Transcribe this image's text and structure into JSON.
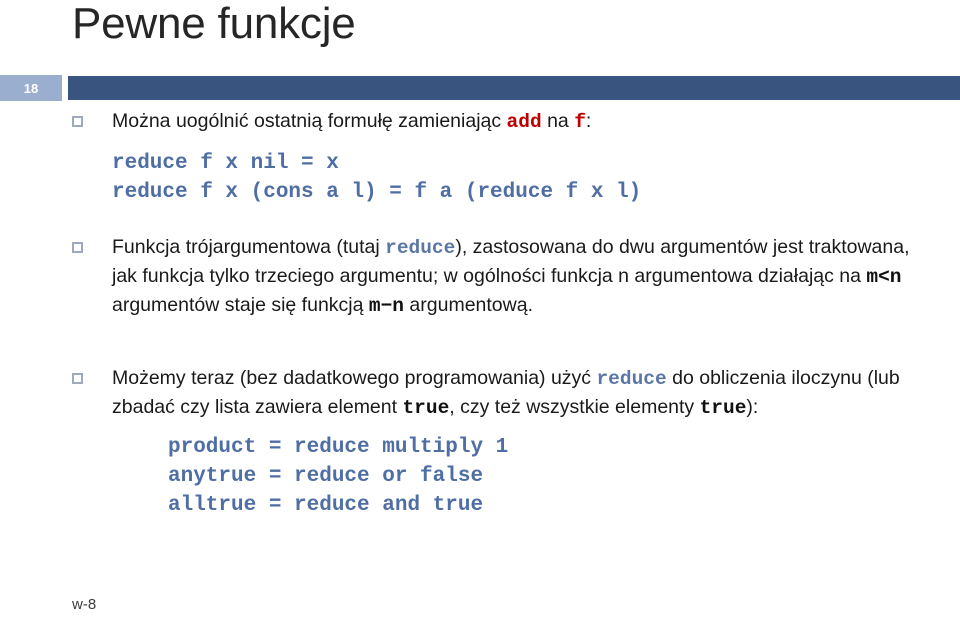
{
  "slide": {
    "title": "Pewne funkcje",
    "number": "18",
    "footer": "w-8",
    "colors": {
      "header_bar": "#39547f",
      "number_badge": "#9aaed0",
      "code_blue": "#4f6ea4",
      "inline_red": "#c00000",
      "inline_blue": "#5b77a6",
      "bullet_marker": "#9fa9bd",
      "title_text": "#262626"
    }
  },
  "bullets": [
    {
      "id": "bullet-generalize",
      "parts": [
        {
          "type": "text",
          "value": "Można uogólnić ostatnią formułę zamieniając "
        },
        {
          "type": "mono-red",
          "value": "add"
        },
        {
          "type": "text",
          "value": " na "
        },
        {
          "type": "mono-red",
          "value": "f"
        },
        {
          "type": "text",
          "value": ":"
        }
      ]
    },
    {
      "id": "bullet-three-arg",
      "parts": [
        {
          "type": "text",
          "value": "Funkcja trójargumentowa (tutaj "
        },
        {
          "type": "mono-blue",
          "value": "reduce"
        },
        {
          "type": "text",
          "value": "), zastosowana do dwu argumentów jest traktowana, jak funkcja tylko trzeciego argumentu; w ogólności funkcja n argumentowa działając na "
        },
        {
          "type": "mono-black",
          "value": "m<n"
        },
        {
          "type": "text",
          "value": "  argumentów staje się funkcją "
        },
        {
          "type": "mono-black",
          "value": "m−n"
        },
        {
          "type": "text",
          "value": " argumentową."
        }
      ]
    },
    {
      "id": "bullet-no-extra-programming",
      "parts": [
        {
          "type": "text",
          "value": "Możemy teraz (bez dadatkowego programowania) użyć "
        },
        {
          "type": "mono-blue",
          "value": "reduce"
        },
        {
          "type": "text",
          "value": " do obliczenia iloczynu (lub zbadać czy lista zawiera element "
        },
        {
          "type": "mono-black",
          "value": "true"
        },
        {
          "type": "text",
          "value": ", czy też wszystkie elementy "
        },
        {
          "type": "mono-black",
          "value": "true"
        },
        {
          "type": "text",
          "value": "):"
        }
      ]
    }
  ],
  "code_blocks": [
    {
      "id": "code-reduce-definition",
      "lines": [
        "reduce f x nil = x",
        "reduce f x (cons a l) = f a (reduce f x l)"
      ]
    },
    {
      "id": "code-derived-functions",
      "lines": [
        "product = reduce multiply 1",
        "anytrue = reduce or false",
        "alltrue = reduce and true"
      ]
    }
  ]
}
